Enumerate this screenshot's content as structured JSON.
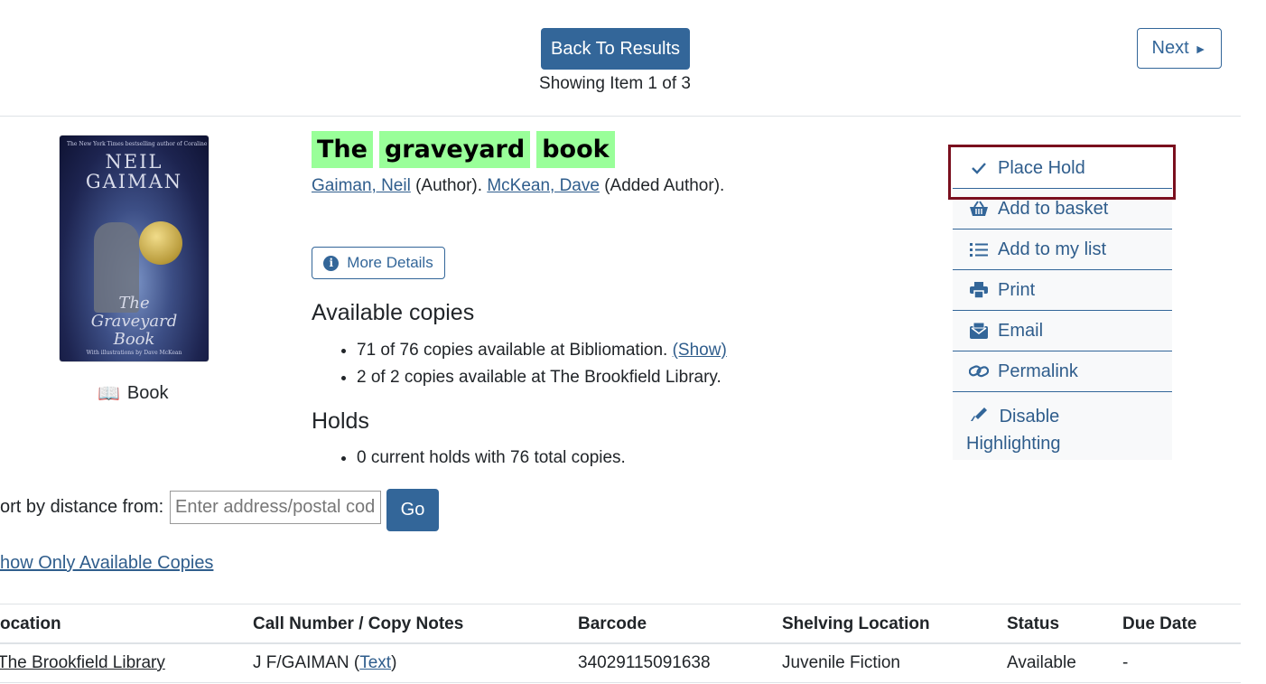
{
  "nav": {
    "back_label": "Back To Results",
    "showing": "Showing Item 1 of 3",
    "next_label": "Next",
    "next_arrow": "►"
  },
  "record": {
    "cover": {
      "top_line": "The New York Times bestselling author of Coraline",
      "author_line1": "NEIL",
      "author_line2": "GAIMAN",
      "title_line1": "The",
      "title_line2": "Graveyard",
      "title_line3": "Book",
      "illus": "With illustrations by Dave McKean"
    },
    "format": "Book",
    "format_icon": "book-icon",
    "title_words": [
      "The",
      "graveyard",
      "book"
    ],
    "author1": "Gaiman, Neil",
    "author1_role": " (Author). ",
    "author2": "McKean, Dave",
    "author2_role": " (Added Author)."
  },
  "more_details_label": "More Details",
  "available": {
    "heading": "Available copies",
    "item1": "71 of 76 copies available at Bibliomation. ",
    "item1_link": "(Show)",
    "item2": "2 of 2 copies available at The Brookfield Library."
  },
  "holds": {
    "heading": "Holds",
    "item1": "0 current holds with 76 total copies."
  },
  "actions": {
    "place_hold": "Place Hold",
    "add_basket": "Add to basket",
    "add_list": "Add to my list",
    "print": "Print",
    "email": "Email",
    "permalink": "Permalink",
    "disable_highlighting_1": "Disable",
    "disable_highlighting_2": "Highlighting"
  },
  "sort": {
    "label": "ort by distance from:",
    "placeholder": "Enter address/postal code",
    "go": "Go"
  },
  "show_only": "how Only Available Copies",
  "table": {
    "headers": [
      "Location",
      "Call Number / Copy Notes",
      "Barcode",
      "Shelving Location",
      "Status",
      "Due Date"
    ],
    "header_loc": "ocation",
    "row": {
      "location": "The Brookfield Library",
      "call_number": "J F/GAIMAN (",
      "call_link": "Text",
      "call_close": ")",
      "barcode": "34029115091638",
      "shelving": "Juvenile Fiction",
      "status": "Available",
      "due": "-"
    }
  },
  "colors": {
    "primary": "#336699",
    "title_highlight": "#99ff99",
    "focus_box": "#7a0f1e"
  }
}
